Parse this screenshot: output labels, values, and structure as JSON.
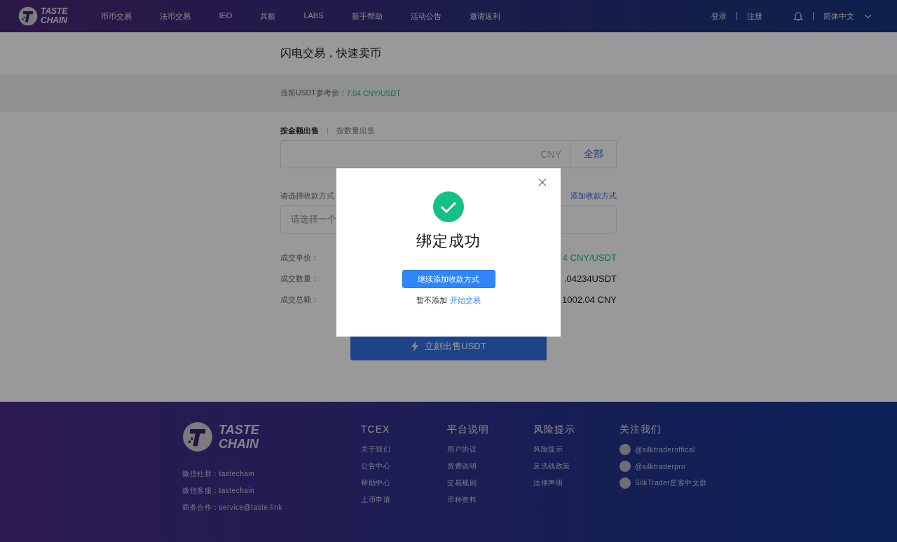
{
  "header": {
    "logo_text": [
      "TASTE",
      "CHAIN"
    ],
    "nav": [
      {
        "label": "币币交易"
      },
      {
        "label": "法币交易"
      },
      {
        "label": "IEO"
      },
      {
        "label": "共振"
      },
      {
        "label": "LABS"
      },
      {
        "label": "新手帮助"
      },
      {
        "label": "活动公告"
      },
      {
        "label": "邀请返利"
      }
    ],
    "auth": [
      "登录",
      "注册"
    ],
    "language": "简体中文"
  },
  "title": "闪电交易，快速卖币",
  "price": {
    "label": "当前USDT参考价：",
    "value": "7.04 CNY/USDT"
  },
  "sell_tabs": [
    {
      "label": "按金额出售",
      "selected": true
    },
    {
      "label": "按数量出售",
      "selected": false
    }
  ],
  "amount": {
    "unit": "CNY",
    "all_button": "全部"
  },
  "payment": {
    "label": "请选择收款方式",
    "add_link": "添加收款方式",
    "placeholder": "请选择一个"
  },
  "summary": [
    {
      "label": "成交单价：",
      "value": "4 CNY/USDT",
      "kind": "rate"
    },
    {
      "label": "成交数量：",
      "value": ".04234USDT",
      "kind": "plain"
    },
    {
      "label": "成交总额：",
      "value": "1002.04 CNY",
      "kind": "plain"
    }
  ],
  "submit": "立刻出售USDT",
  "footer": {
    "logo_text": [
      "TASTE",
      "CHAIN"
    ],
    "contacts": [
      "微信社群：tastechain",
      "微信客服：tastechain",
      "商务合作：service@taste.link"
    ],
    "columns": [
      {
        "title": "TCEX",
        "links": [
          "关于我们",
          "公告中心",
          "帮助中心",
          "上币申请"
        ]
      },
      {
        "title": "平台说明",
        "links": [
          "用户协议",
          "资费说明",
          "交易规则",
          "币种资料"
        ]
      },
      {
        "title": "风险提示",
        "links": [
          "风险提示",
          "反洗钱政策",
          "法律声明"
        ]
      },
      {
        "title": "关注我们",
        "kind": "social",
        "links": [
          "@silktraderoffical",
          "@silktraderpro",
          "SilkTrader星客中文群"
        ]
      }
    ]
  },
  "modal": {
    "title": "绑定成功",
    "primary": "继续添加收款方式",
    "skip_text": "暂不添加",
    "start_link": "开始交易"
  }
}
